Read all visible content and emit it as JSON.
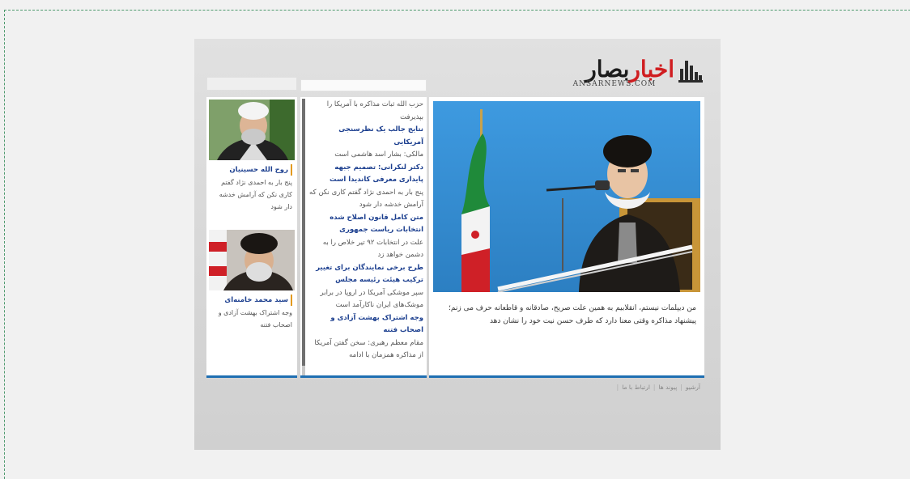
{
  "site": {
    "logo_prefix": "اخبار",
    "logo_suffix": "بصار",
    "logo_subtitle": "ANSARNEWS.COM"
  },
  "main": {
    "lead_text": "من دیپلمات نیستم، انقلابیم به همین علت صریح، صادقانه و قاطعانه حرف می زنم؛ پیشنهاد مذاکره وقتی معنا دارد که طرف حسن نیت خود را نشان دهد"
  },
  "news": {
    "header": "",
    "items": [
      {
        "type": "text",
        "content": "حزب الله ثبات مذاکره با آمریکا را بپذیرفت"
      },
      {
        "type": "link",
        "content": "نتایج جالب یک نظرسنجی آمریکایی"
      },
      {
        "type": "text",
        "content": "مالکی: بشار اسد هاشمی است"
      },
      {
        "type": "link",
        "content": "دکتر لنکرانی: تصمیم جبهه پایداری معرفی کاندیدا است"
      },
      {
        "type": "text",
        "content": "پنج بار به احمدی نژاد گفتم کاری نکن که آرامش خدشه دار شود"
      },
      {
        "type": "link",
        "content": "متن کامل قانون اصلاح شده انتخابات ریاست جمهوری"
      },
      {
        "type": "text",
        "content": "علت در انتخابات ۹۲ تیر خلاص را به دشمن خواهد زد"
      },
      {
        "type": "link",
        "content": "طرح برخی نمایندگان برای تغییر ترکیب هیئت رئیسه مجلس"
      },
      {
        "type": "text",
        "content": "سپر موشکی آمریکا در اروپا در برابر موشک‌های ایران ناکارآمد است"
      },
      {
        "type": "link",
        "content": "وجه اشتراک بهشت آزادی و اصحاب فتنه"
      },
      {
        "type": "text",
        "content": "مقام معظم رهبری: سخن گفتن آمریکا از مذاکره همزمان با ادامه"
      }
    ]
  },
  "columnists": {
    "header": "",
    "items": [
      {
        "name": "روح الله حسینیان",
        "text": "پنج بار به احمدی نژاد گفتم کاری نکن که آرامش خدشه دار شود"
      },
      {
        "name": "سید محمد خامنه‌ای",
        "text": "وجه اشتراک بهشت آزادی و اصحاب فتنه"
      }
    ]
  },
  "footer": {
    "links": [
      "آرشیو",
      "پیوند ها",
      "ارتباط با ما"
    ]
  },
  "colors": {
    "accent_blue": "#1f6fb2",
    "brand_red": "#d01d20",
    "link_blue": "#1c3f8f",
    "marker_orange": "#e39a1f"
  }
}
